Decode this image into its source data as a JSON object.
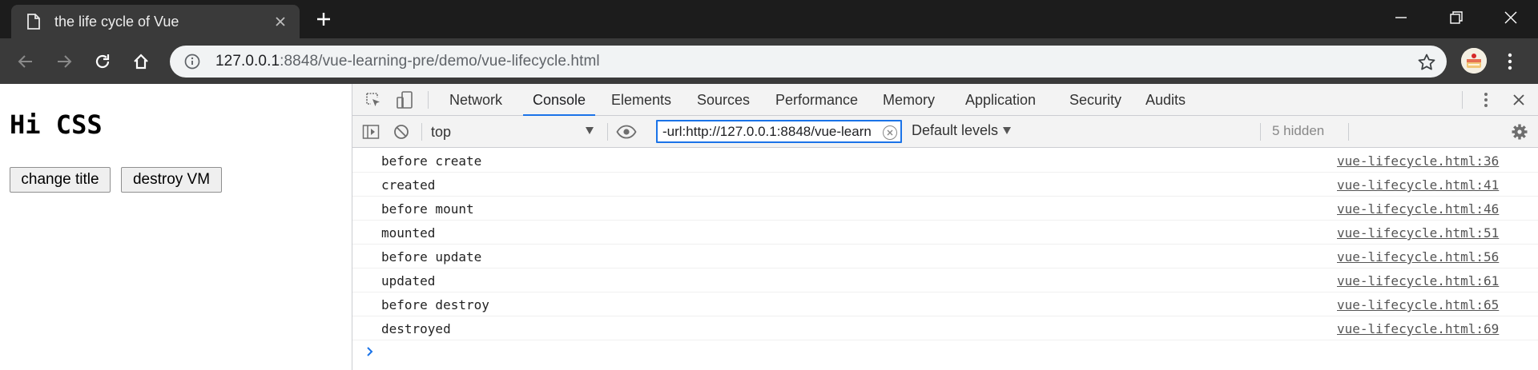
{
  "browser": {
    "tab_title": "the life cycle of Vue",
    "url_host": "127.0.0.1",
    "url_rest": ":8848/vue-learning-pre/demo/vue-lifecycle.html"
  },
  "page": {
    "heading": "Hi CSS",
    "buttons": {
      "change_title": "change title",
      "destroy_vm": "destroy VM"
    }
  },
  "devtools": {
    "tabs": [
      "Network",
      "Console",
      "Elements",
      "Sources",
      "Performance",
      "Memory",
      "Application",
      "Security",
      "Audits"
    ],
    "active_tab": "Console",
    "context": "top",
    "filter_value": "-url:http://127.0.0.1:8848/vue-learn",
    "levels": "Default levels",
    "hidden": "5 hidden",
    "logs": [
      {
        "message": "before create",
        "source": "vue-lifecycle.html:36"
      },
      {
        "message": "created",
        "source": "vue-lifecycle.html:41"
      },
      {
        "message": "before mount",
        "source": "vue-lifecycle.html:46"
      },
      {
        "message": "mounted",
        "source": "vue-lifecycle.html:51"
      },
      {
        "message": "before update",
        "source": "vue-lifecycle.html:56"
      },
      {
        "message": "updated",
        "source": "vue-lifecycle.html:61"
      },
      {
        "message": "before destroy",
        "source": "vue-lifecycle.html:65"
      },
      {
        "message": "destroyed",
        "source": "vue-lifecycle.html:69"
      }
    ]
  },
  "colors": {
    "titlebar": "#1c1c1c",
    "toolbar": "#3a3a3a",
    "devtools_accent": "#1a73e8"
  },
  "icons": [
    "document-icon",
    "tab-close-icon",
    "new-tab-icon",
    "minimize-icon",
    "restore-icon",
    "window-close-icon",
    "back-icon",
    "forward-icon",
    "reload-icon",
    "home-icon",
    "info-icon",
    "bookmark-star-icon",
    "profile-avatar",
    "browser-menu-icon",
    "inspect-element-icon",
    "device-toolbar-icon",
    "devtools-menu-icon",
    "devtools-close-icon",
    "sidebar-toggle-icon",
    "clear-console-icon",
    "live-expression-eye-icon",
    "settings-gear-icon",
    "console-prompt-icon"
  ]
}
